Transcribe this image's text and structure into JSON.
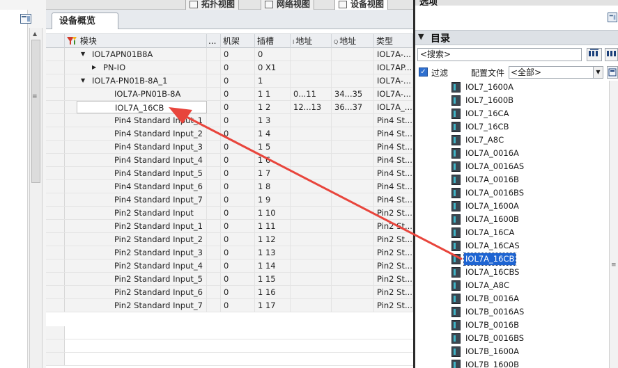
{
  "view_tabs": [
    {
      "label": "拓扑视图",
      "active": false
    },
    {
      "label": "网络视图",
      "active": false
    },
    {
      "label": "设备视图",
      "active": true
    }
  ],
  "overview_tab": "设备概览",
  "columns": {
    "module": "模块",
    "ellipsis": "...",
    "rack": "机架",
    "slot": "插槽",
    "i_addr": "地址",
    "i_prefix": "I",
    "q_addr": "地址",
    "q_prefix": "Q",
    "type": "类型"
  },
  "rows": [
    {
      "indent": 1,
      "tree": "expanded",
      "name": "IOL7APN01B8A",
      "rack": "0",
      "slot": "0",
      "i_addr": "",
      "q_addr": "",
      "type": "IOL7A-...",
      "shaded": true
    },
    {
      "indent": 2,
      "tree": "collapsed",
      "name": "PN-IO",
      "rack": "0",
      "slot": "0 X1",
      "i_addr": "",
      "q_addr": "",
      "type": "IOL7AP...",
      "shaded": true
    },
    {
      "indent": 1,
      "tree": "expanded",
      "name": "IOL7A-PN01B-8A_1",
      "rack": "0",
      "slot": "1",
      "i_addr": "",
      "q_addr": "",
      "type": "IOL7A-...",
      "shaded": true
    },
    {
      "indent": 3,
      "tree": "none",
      "name": "IOL7A-PN01B-8A",
      "rack": "0",
      "slot": "1 1",
      "i_addr": "0...11",
      "q_addr": "34...35",
      "type": "IOL7A-...",
      "shaded": true
    },
    {
      "indent": 3,
      "tree": "none",
      "name": "IOL7A_16CB",
      "rack": "0",
      "slot": "1 2",
      "i_addr": "12...13",
      "q_addr": "36...37",
      "type": "IOL7A_...",
      "shaded": true,
      "selected": true
    },
    {
      "indent": 3,
      "tree": "none",
      "name": "Pin4 Standard Input_1",
      "rack": "0",
      "slot": "1 3",
      "i_addr": "",
      "q_addr": "",
      "type": "Pin4 St...",
      "shaded": true
    },
    {
      "indent": 3,
      "tree": "none",
      "name": "Pin4 Standard Input_2",
      "rack": "0",
      "slot": "1 4",
      "i_addr": "",
      "q_addr": "",
      "type": "Pin4 St...",
      "shaded": true
    },
    {
      "indent": 3,
      "tree": "none",
      "name": "Pin4 Standard Input_3",
      "rack": "0",
      "slot": "1 5",
      "i_addr": "",
      "q_addr": "",
      "type": "Pin4 St...",
      "shaded": true
    },
    {
      "indent": 3,
      "tree": "none",
      "name": "Pin4 Standard Input_4",
      "rack": "0",
      "slot": "1 6",
      "i_addr": "",
      "q_addr": "",
      "type": "Pin4 St...",
      "shaded": true
    },
    {
      "indent": 3,
      "tree": "none",
      "name": "Pin4 Standard Input_5",
      "rack": "0",
      "slot": "1 7",
      "i_addr": "",
      "q_addr": "",
      "type": "Pin4 St...",
      "shaded": true
    },
    {
      "indent": 3,
      "tree": "none",
      "name": "Pin4 Standard Input_6",
      "rack": "0",
      "slot": "1 8",
      "i_addr": "",
      "q_addr": "",
      "type": "Pin4 St...",
      "shaded": true
    },
    {
      "indent": 3,
      "tree": "none",
      "name": "Pin4 Standard Input_7",
      "rack": "0",
      "slot": "1 9",
      "i_addr": "",
      "q_addr": "",
      "type": "Pin4 St...",
      "shaded": true
    },
    {
      "indent": 3,
      "tree": "none",
      "name": "Pin2 Standard Input",
      "rack": "0",
      "slot": "1 10",
      "i_addr": "",
      "q_addr": "",
      "type": "Pin2 St...",
      "shaded": true
    },
    {
      "indent": 3,
      "tree": "none",
      "name": "Pin2 Standard Input_1",
      "rack": "0",
      "slot": "1 11",
      "i_addr": "",
      "q_addr": "",
      "type": "Pin2 St...",
      "shaded": true
    },
    {
      "indent": 3,
      "tree": "none",
      "name": "Pin2 Standard Input_2",
      "rack": "0",
      "slot": "1 12",
      "i_addr": "",
      "q_addr": "",
      "type": "Pin2 St...",
      "shaded": true
    },
    {
      "indent": 3,
      "tree": "none",
      "name": "Pin2 Standard Input_3",
      "rack": "0",
      "slot": "1 13",
      "i_addr": "",
      "q_addr": "",
      "type": "Pin2 St...",
      "shaded": true
    },
    {
      "indent": 3,
      "tree": "none",
      "name": "Pin2 Standard Input_4",
      "rack": "0",
      "slot": "1 14",
      "i_addr": "",
      "q_addr": "",
      "type": "Pin2 St...",
      "shaded": true
    },
    {
      "indent": 3,
      "tree": "none",
      "name": "Pin2 Standard Input_5",
      "rack": "0",
      "slot": "1 15",
      "i_addr": "",
      "q_addr": "",
      "type": "Pin2 St...",
      "shaded": true
    },
    {
      "indent": 3,
      "tree": "none",
      "name": "Pin2 Standard Input_6",
      "rack": "0",
      "slot": "1 16",
      "i_addr": "",
      "q_addr": "",
      "type": "Pin2 St...",
      "shaded": true
    },
    {
      "indent": 3,
      "tree": "none",
      "name": "Pin2 Standard Input_7",
      "rack": "0",
      "slot": "1 17",
      "i_addr": "",
      "q_addr": "",
      "type": "Pin2 St...",
      "shaded": true
    }
  ],
  "right_pane": {
    "title": "选项",
    "catalog_title": "目录",
    "search_placeholder": "<搜索>",
    "filter_label": "过滤",
    "filter_checked": true,
    "profile_label": "配置文件",
    "profile_value": "<全部>",
    "catalog_items": [
      "IOL7_1600A",
      "IOL7_1600B",
      "IOL7_16CA",
      "IOL7_16CB",
      "IOL7_A8C",
      "IOL7A_0016A",
      "IOL7A_0016AS",
      "IOL7A_0016B",
      "IOL7A_0016BS",
      "IOL7A_1600A",
      "IOL7A_1600B",
      "IOL7A_16CA",
      "IOL7A_16CAS",
      "IOL7A_16CB",
      "IOL7A_16CBS",
      "IOL7A_A8C",
      "IOL7B_0016A",
      "IOL7B_0016AS",
      "IOL7B_0016B",
      "IOL7B_0016BS",
      "IOL7B_1600A",
      "IOL7B_1600B"
    ],
    "selected_item": "IOL7A_16CB"
  },
  "colors": {
    "annotation_arrow": "#e8453c",
    "selection": "#1e64d2"
  },
  "icons": {
    "module_column": "module-filter-icon",
    "catalog_item": "module-icon",
    "search_buttons": [
      "search-down-icon",
      "search-up-icon"
    ]
  }
}
